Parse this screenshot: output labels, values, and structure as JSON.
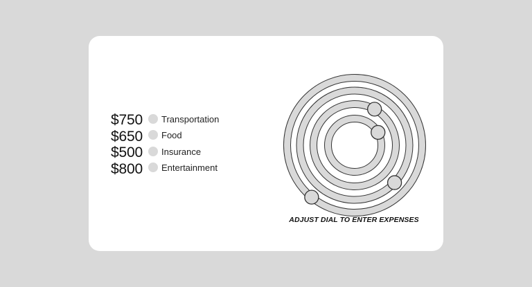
{
  "expenses": [
    {
      "amount": "$750",
      "label": "Transportation",
      "dial_fraction": 0.61
    },
    {
      "amount": "$650",
      "label": "Food",
      "dial_fraction": 0.37
    },
    {
      "amount": "$500",
      "label": "Insurance",
      "dial_fraction": 0.08
    },
    {
      "amount": "$800",
      "label": "Entertainment",
      "dial_fraction": 0.17
    }
  ],
  "dial": {
    "caption": "ADJUST DIAL TO ENTER EXPENSES",
    "track_color": "#d9d9d9",
    "stroke_color": "#333333"
  }
}
